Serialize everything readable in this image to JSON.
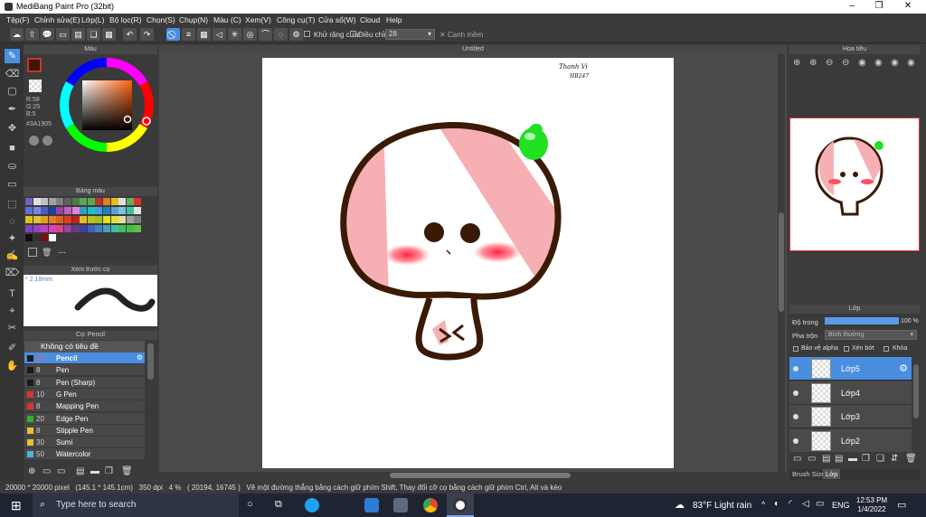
{
  "title": "MediBang Paint Pro (32bit)",
  "menu": [
    "Tệp(F)",
    "Chỉnh sửa(E)",
    "Lớp(L)",
    "Bộ lọc(R)",
    "Chọn(S)",
    "Chụp(N)",
    "Màu (C)",
    "Xem(V)",
    "Công cụ(T)",
    "Cửa sổ(W)",
    "Cloud",
    "Help"
  ],
  "toolbar": {
    "antialias_label": "Khử răng cưa",
    "adjust_label": "Điều chỉnh",
    "adjust_value": "28",
    "soften_label": "Cạnh mềm"
  },
  "color_panel": {
    "title": "Màu",
    "r": "R:58",
    "g": "G:25",
    "b": "B:5",
    "hex": "#3A1905",
    "fg_color": "#3A1905"
  },
  "palette_panel": {
    "title": "Bảng màu",
    "dash": "---"
  },
  "preview_panel": {
    "title": "Xem trước cọ",
    "size": "* 2.18mm"
  },
  "brush_panel": {
    "title": "Cọ: Pencil",
    "group": "Không có tiêu đề",
    "items": [
      {
        "size": "30",
        "name": "Pencil",
        "color": "#1a1a1a",
        "selected": true
      },
      {
        "size": "8",
        "name": "Pen",
        "color": "#1a1a1a"
      },
      {
        "size": "8",
        "name": "Pen (Sharp)",
        "color": "#1a1a1a"
      },
      {
        "size": "10",
        "name": "G Pen",
        "color": "#e03030"
      },
      {
        "size": "8",
        "name": "Mapping Pen",
        "color": "#e03030"
      },
      {
        "size": "20",
        "name": "Edge Pen",
        "color": "#30b030"
      },
      {
        "size": "8",
        "name": "Stipple Pen",
        "color": "#e8c030"
      },
      {
        "size": "30",
        "name": "Sumi",
        "color": "#e8c030"
      },
      {
        "size": "50",
        "name": "Watercolor",
        "color": "#50b0e8"
      }
    ]
  },
  "canvas": {
    "tab": "Untitled",
    "signature_1": "Thanh Vi",
    "signature_2": "HB247"
  },
  "navigator": {
    "title": "Hoa tiêu"
  },
  "layer_panel": {
    "title": "Lớp",
    "opacity_label": "Độ trong",
    "opacity_value": "100 %",
    "opacity_fraction": 1.0,
    "blend_label": "Pha trộn",
    "blend_value": "Bình thường",
    "protect_alpha": "Bảo vệ alpha",
    "clipping": "Xén bớt",
    "lock": "Khóa",
    "layers": [
      {
        "name": "Lớp5",
        "selected": true
      },
      {
        "name": "Lớp4"
      },
      {
        "name": "Lớp3"
      },
      {
        "name": "Lớp2"
      }
    ],
    "tab_brush_size": "Brush Size",
    "tab_layer": "Lớp"
  },
  "status": {
    "text": "20000 * 20000 pixel   (145.1 * 145.1cm)   350 dpi   4 %   ( 20194, 16745 )   Vẽ một đường thẳng bằng cách giữ phím Shift, Thay đổi cỡ cọ bằng cách giữ phím Ctrl, Alt và kéo"
  },
  "taskbar": {
    "search": "Type here to search",
    "weather": "83°F  Light rain",
    "lang": "ENG",
    "time": "12:53 PM",
    "date": "1/4/2022"
  }
}
